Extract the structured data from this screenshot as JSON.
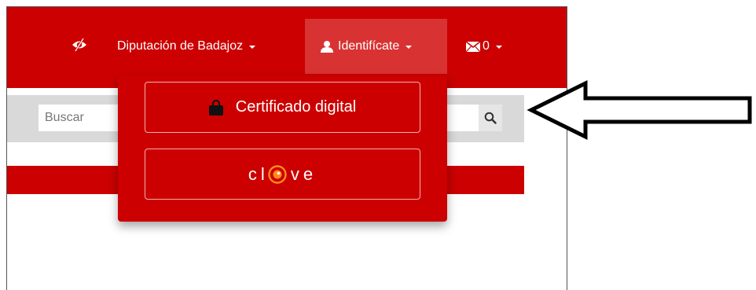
{
  "navbar": {
    "accessibility_icon": "eye-slash-icon",
    "org_label": "Diputación de Badajoz",
    "login_label": "Identifícate",
    "messages_count": "0"
  },
  "search": {
    "placeholder": "Buscar",
    "icon": "search-icon"
  },
  "dropdown": {
    "certificate_label": "Certificado digital",
    "certificate_icon": "lock-icon",
    "clave_prefix": "cl",
    "clave_suffix": "ve"
  },
  "colors": {
    "brand_red": "#cc0000",
    "active_red": "#d93232",
    "search_bg": "#d9d9d9",
    "clave_orange": "#ff8c1a"
  }
}
